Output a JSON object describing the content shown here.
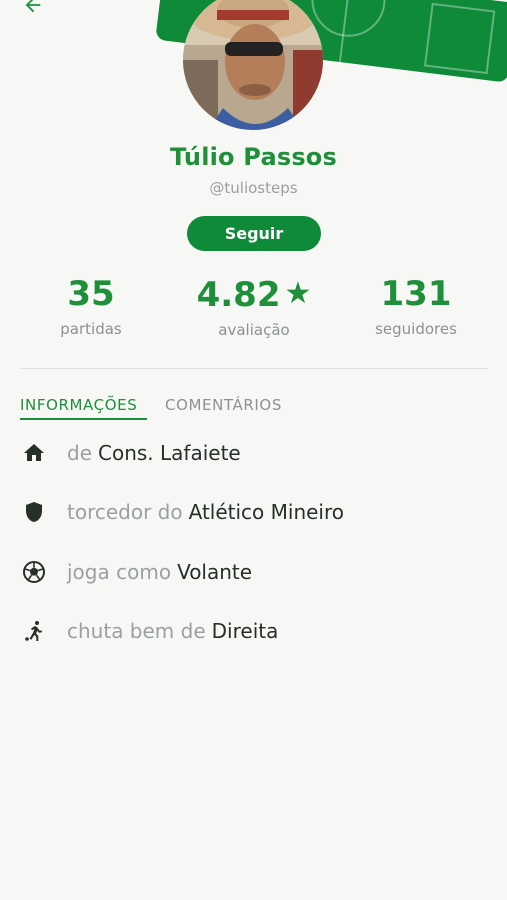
{
  "profile": {
    "name": "Túlio Passos",
    "handle": "@tuliosteps",
    "follow_label": "Seguir"
  },
  "stats": [
    {
      "value": "35",
      "label": "partidas"
    },
    {
      "value": "4.82",
      "label": "avaliação"
    },
    {
      "value": "131",
      "label": "seguidores"
    }
  ],
  "tabs": [
    {
      "label": "INFORMAÇÕES",
      "active": true
    },
    {
      "label": "COMENTÁRIOS",
      "active": false
    }
  ],
  "info": [
    {
      "icon": "home-icon",
      "prefix": "de",
      "value": "Cons. Lafaiete"
    },
    {
      "icon": "shield-icon",
      "prefix": "torcedor do",
      "value": "Atlético Mineiro"
    },
    {
      "icon": "soccer-ball-icon",
      "prefix": "joga como",
      "value": "Volante"
    },
    {
      "icon": "kicking-player-icon",
      "prefix": "chuta bem de",
      "value": "Direita"
    }
  ],
  "colors": {
    "brand_green": "#0f8a39",
    "text_green": "#1f8f3a",
    "muted": "#9aa0a0",
    "background": "#f7f8f6"
  }
}
